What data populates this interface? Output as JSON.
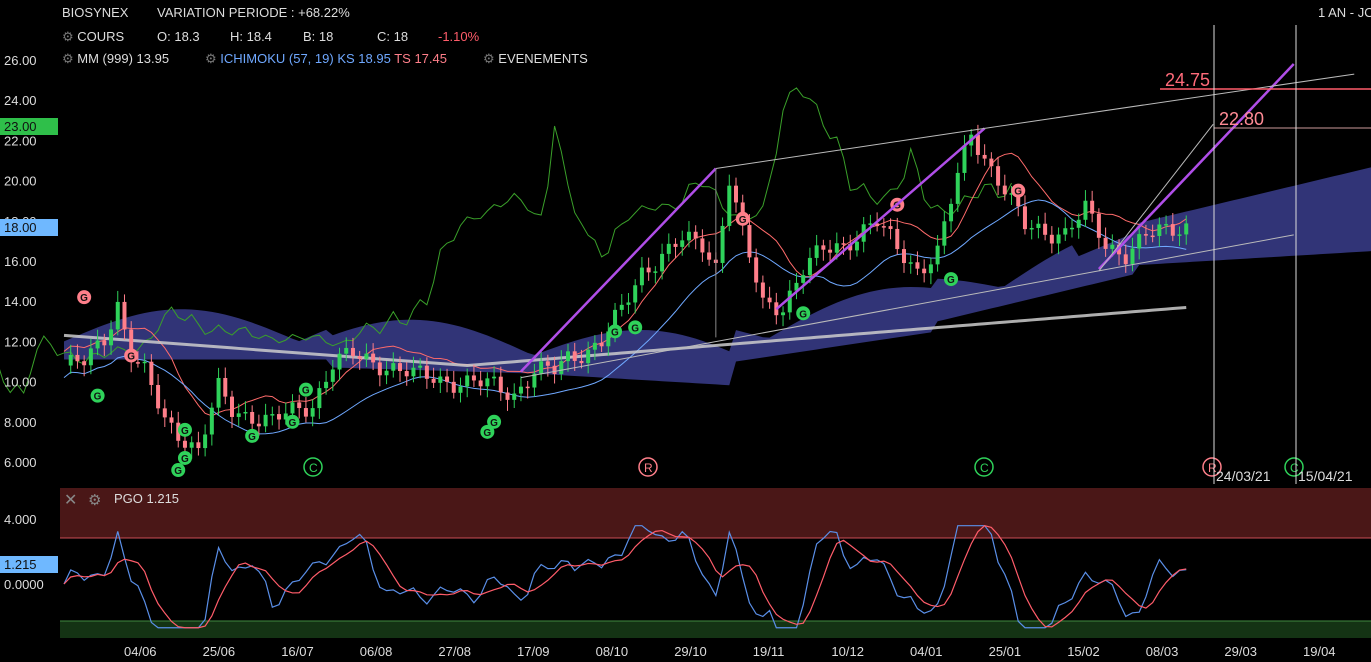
{
  "header": {
    "symbol": "BIOSYNEX",
    "variation": "VARIATION PERIODE : +68.22%",
    "period": "1 AN - JO",
    "cours_label": "COURS",
    "open": "O: 18.3",
    "high": "H: 18.4",
    "low": "B: 18",
    "close": "C: 18",
    "change": "-1.10%",
    "mm": "MM (999) 13.95",
    "ichimoku_label": "ICHIMOKU (57, 19)",
    "ks": "KS 18.95",
    "ts": "TS 17.45",
    "evenements": "EVENEMENTS"
  },
  "price_badges": {
    "green": "23.00",
    "blue": "18.00"
  },
  "annotations": {
    "level1": "24.75",
    "level2": "22.80",
    "date1": "24/03/21",
    "date2": "15/04/21",
    "markers": [
      "C",
      "R",
      "C",
      "R",
      "C"
    ]
  },
  "indicator": {
    "label": "PGO 1.215",
    "badge": "1.215",
    "ticks": [
      "4.000",
      "0.0000"
    ]
  },
  "colors": {
    "bull": "#2fd25a",
    "bear": "#ff7f8a",
    "cloud": "#3a3d8c",
    "ks": "#ff6b6b",
    "ts": "#6fa8ff",
    "chikou": "#3aa02a",
    "ma": "#cccccc",
    "trend": "#b04ee8"
  },
  "chart_data": {
    "type": "candlestick",
    "xlabel": "",
    "ylabel": "",
    "ylim": [
      5,
      27
    ],
    "y_ticks": [
      6,
      8,
      10,
      12,
      14,
      16,
      18,
      20,
      22,
      24,
      26
    ],
    "y_tick_labels": [
      "6.000",
      "8.000",
      "10.00",
      "12.00",
      "14.00",
      "16.00",
      "18.00",
      "20.00",
      "22.00",
      "24.00",
      "26.00"
    ],
    "x_tick_labels": [
      "04/06",
      "25/06",
      "16/07",
      "06/08",
      "27/08",
      "17/09",
      "08/10",
      "29/10",
      "19/11",
      "10/12",
      "04/01",
      "25/01",
      "15/02",
      "08/03",
      "29/03",
      "19/04"
    ],
    "close_path": [
      [
        0,
        10.8
      ],
      [
        3,
        10.9
      ],
      [
        6,
        12.2
      ],
      [
        8,
        13.9
      ],
      [
        10,
        11.3
      ],
      [
        12,
        10.4
      ],
      [
        15,
        8.1
      ],
      [
        18,
        7.2
      ],
      [
        20,
        6.5
      ],
      [
        23,
        9.6
      ],
      [
        25,
        8.6
      ],
      [
        28,
        8.3
      ],
      [
        31,
        8.0
      ],
      [
        34,
        8.5
      ],
      [
        37,
        8.9
      ],
      [
        40,
        10.9
      ],
      [
        43,
        11.3
      ],
      [
        46,
        11.0
      ],
      [
        49,
        10.7
      ],
      [
        52,
        10.3
      ],
      [
        55,
        10.2
      ],
      [
        58,
        10.0
      ],
      [
        61,
        9.9
      ],
      [
        64,
        9.8
      ],
      [
        67,
        9.4
      ],
      [
        70,
        10.5
      ],
      [
        73,
        10.5
      ],
      [
        75,
        11.2
      ],
      [
        78,
        11.6
      ],
      [
        80,
        12.0
      ],
      [
        83,
        13.5
      ],
      [
        86,
        15.5
      ],
      [
        89,
        16.3
      ],
      [
        92,
        17.0
      ],
      [
        95,
        16.8
      ],
      [
        97,
        15.8
      ],
      [
        99,
        20.2
      ],
      [
        101,
        17.3
      ],
      [
        104,
        13.8
      ],
      [
        107,
        13.8
      ],
      [
        110,
        15.6
      ],
      [
        113,
        16.5
      ],
      [
        116,
        16.8
      ],
      [
        119,
        17.6
      ],
      [
        121,
        17.9
      ],
      [
        124,
        16.6
      ],
      [
        127,
        15.6
      ],
      [
        130,
        16.4
      ],
      [
        133,
        20.2
      ],
      [
        135,
        22.4
      ],
      [
        137,
        21.2
      ],
      [
        140,
        19.5
      ],
      [
        143,
        17.7
      ],
      [
        146,
        17.5
      ],
      [
        149,
        17.4
      ],
      [
        152,
        18.5
      ],
      [
        155,
        16.8
      ],
      [
        158,
        16.4
      ],
      [
        161,
        17.2
      ],
      [
        164,
        17.5
      ],
      [
        167,
        17.8
      ]
    ],
    "moving_average": {
      "name": "MM (999)",
      "last": 13.95
    },
    "ichimoku": {
      "kijun": 18.95,
      "tenkan": 17.45
    },
    "levels": [
      24.75,
      22.8
    ],
    "indicator": {
      "name": "PGO",
      "last": 1.215
    }
  }
}
